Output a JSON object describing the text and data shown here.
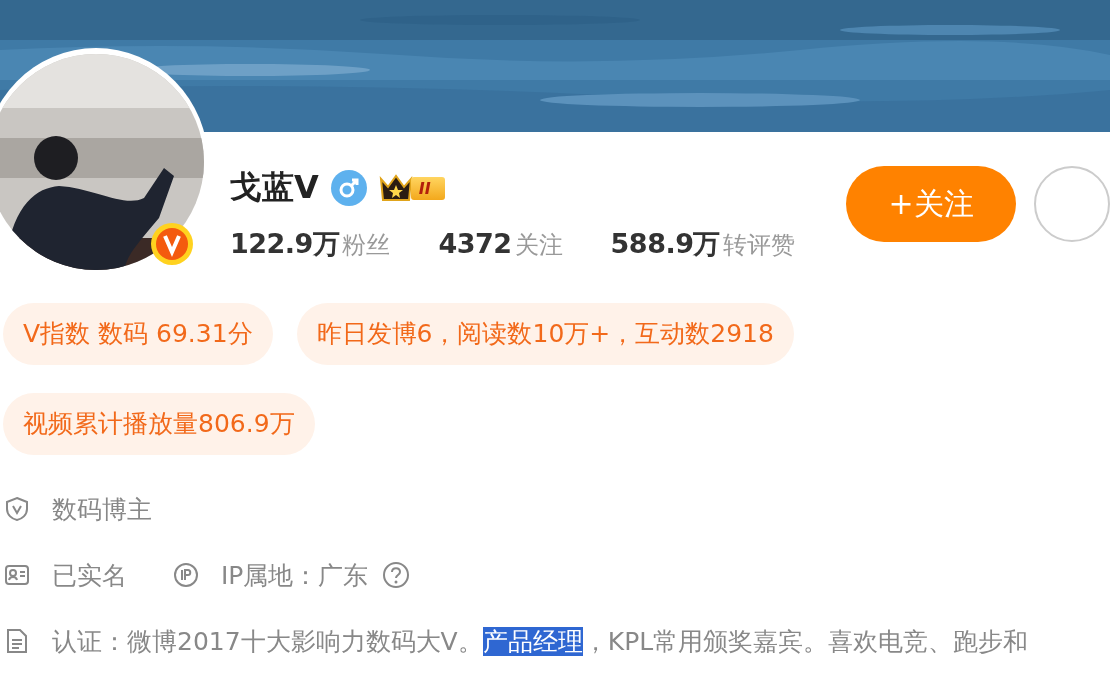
{
  "profile": {
    "name": "戈蓝V",
    "verified": true,
    "level_badge": "II"
  },
  "stats": [
    {
      "value": "122.9万",
      "label": "粉丝"
    },
    {
      "value": "4372",
      "label": "关注"
    },
    {
      "value": "588.9万",
      "label": "转评赞"
    }
  ],
  "follow_button": "+关注",
  "tags": [
    {
      "text": "V指数 数码 69.31分"
    },
    {
      "text": "昨日发博6，阅读数10万+，互动数2918"
    },
    {
      "text": "视频累计播放量806.9万"
    }
  ],
  "info": [
    {
      "kind": "shield",
      "items": [
        {
          "text": "数码博主"
        }
      ]
    },
    {
      "kind": "idcard",
      "items": [
        {
          "text": "已实名"
        },
        {
          "text": "IP属地：广东",
          "kind": "ip",
          "help": true
        }
      ]
    },
    {
      "kind": "document",
      "segments": [
        {
          "text": "认证：微博2017十大影响力数码大V。",
          "selected": false
        },
        {
          "text": "产品经理",
          "selected": true
        },
        {
          "text": "，KPL常用颁奖嘉宾。喜欢电竞、跑步和",
          "selected": false
        }
      ]
    }
  ]
}
